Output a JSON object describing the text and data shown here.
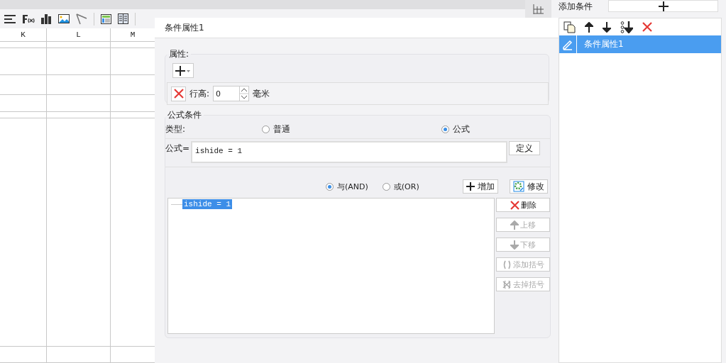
{
  "sheet": {
    "columns": [
      "K",
      "L",
      "M"
    ]
  },
  "dialog": {
    "title": "条件属性1",
    "properties": {
      "legend": "属性:",
      "row_label": "行高:",
      "row_value": "0",
      "row_unit": "毫米"
    },
    "formula_condition": {
      "legend": "公式条件",
      "type_label": "类型:",
      "types": [
        {
          "label": "普通",
          "selected": false
        },
        {
          "label": "公式",
          "selected": true
        }
      ],
      "formula_label": "公式=",
      "formula_value": "ishide = 1",
      "define_button": "定义",
      "logic": [
        {
          "label": "与(AND)",
          "selected": true
        },
        {
          "label": "或(OR)",
          "selected": false
        }
      ],
      "add_button": "增加",
      "modify_button": "修改",
      "conditions": [
        {
          "text": "ishide = 1",
          "selected": true
        }
      ],
      "actions": [
        {
          "label": "删除",
          "kind": "delete",
          "disabled": false
        },
        {
          "label": "上移",
          "kind": "up",
          "disabled": true
        },
        {
          "label": "下移",
          "kind": "down",
          "disabled": true
        },
        {
          "label": "添加括号",
          "kind": "add-paren",
          "disabled": true
        },
        {
          "label": "去掉括号",
          "kind": "remove-paren",
          "disabled": true
        }
      ]
    }
  },
  "conditions_panel": {
    "label": "添加条件",
    "items": [
      {
        "label": "条件属性1",
        "selected": true
      }
    ]
  }
}
